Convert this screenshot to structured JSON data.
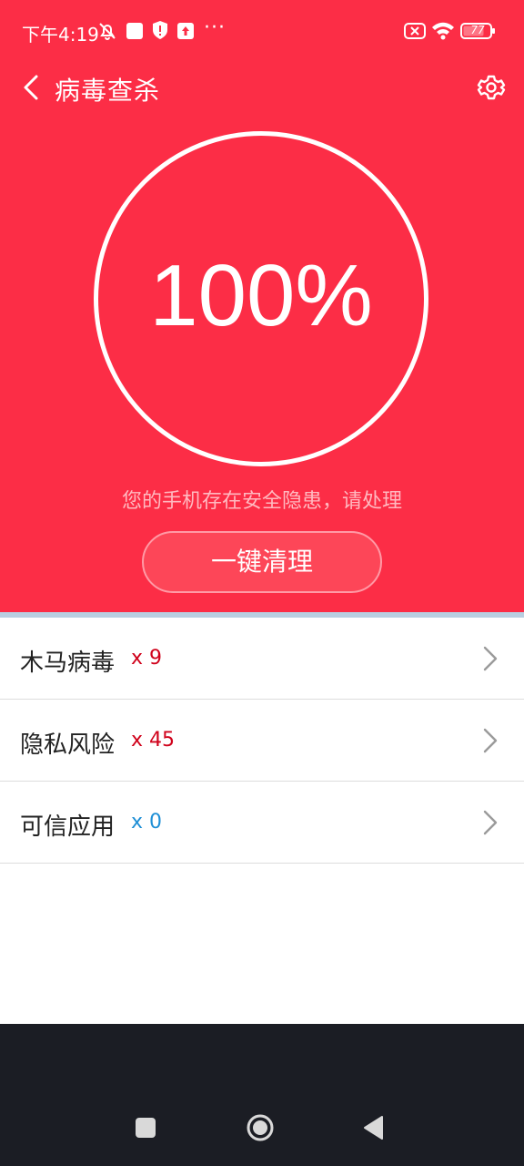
{
  "status_bar": {
    "time": "下午4:19",
    "battery": "77",
    "overflow": "···"
  },
  "header": {
    "title": "病毒查杀"
  },
  "scan": {
    "percent": "100%",
    "warning": "您的手机存在安全隐患，请处理",
    "action_label": "一键清理"
  },
  "results": [
    {
      "label": "木马病毒",
      "count": "x 9",
      "color": "#d0021b"
    },
    {
      "label": "隐私风险",
      "count": "x 45",
      "color": "#d0021b"
    },
    {
      "label": "可信应用",
      "count": "x 0",
      "color": "#1e8fd6"
    }
  ],
  "colors": {
    "accent": "#fc2d46",
    "danger_count": "#d0021b",
    "safe_count": "#1e8fd6",
    "navbar": "#1b1d24"
  }
}
